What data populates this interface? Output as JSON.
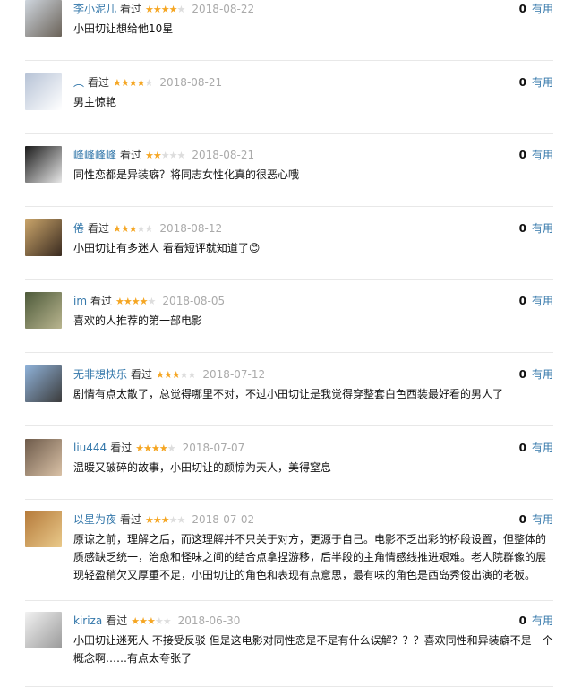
{
  "comments": [
    {
      "user": "李小泥儿",
      "seen": "看过",
      "rating": 4,
      "date": "2018-08-22",
      "votes": "0",
      "useful": "有用",
      "text": "小田切让想给他10星",
      "avatar_colors": [
        "#cfd6de",
        "#6a6258"
      ]
    },
    {
      "user": "︵",
      "seen": "看过",
      "rating": 4,
      "date": "2018-08-21",
      "votes": "0",
      "useful": "有用",
      "text": "男主惊艳",
      "avatar_colors": [
        "#b7c3d6",
        "#ffffff"
      ]
    },
    {
      "user": "峰峰峰峰",
      "seen": "看过",
      "rating": 2,
      "date": "2018-08-21",
      "votes": "0",
      "useful": "有用",
      "text": "同性恋都是异装癖？将同志女性化真的很恶心哦",
      "avatar_colors": [
        "#1a1a1a",
        "#e8e8e8"
      ]
    },
    {
      "user": "倦",
      "seen": "看过",
      "rating": 3,
      "date": "2018-08-12",
      "votes": "0",
      "useful": "有用",
      "text": "小田切让有多迷人 看看短评就知道了😊",
      "avatar_colors": [
        "#c9a46a",
        "#3a2b20"
      ]
    },
    {
      "user": "im",
      "seen": "看过",
      "rating": 4,
      "date": "2018-08-05",
      "votes": "0",
      "useful": "有用",
      "text": "喜欢的人推荐的第一部电影",
      "avatar_colors": [
        "#4d5a3a",
        "#b9b58f"
      ]
    },
    {
      "user": "无非想快乐",
      "seen": "看过",
      "rating": 3,
      "date": "2018-07-12",
      "votes": "0",
      "useful": "有用",
      "text": "剧情有点太散了，总觉得哪里不对，不过小田切让是我觉得穿整套白色西装最好看的男人了",
      "avatar_colors": [
        "#8fb2d9",
        "#3c3c3c"
      ]
    },
    {
      "user": "liu444",
      "seen": "看过",
      "rating": 4,
      "date": "2018-07-07",
      "votes": "0",
      "useful": "有用",
      "text": "温暖又破碎的故事，小田切让的颜惊为天人，美得窒息",
      "avatar_colors": [
        "#6d5a4a",
        "#d9c1a6"
      ]
    },
    {
      "user": "以星为夜",
      "seen": "看过",
      "rating": 3,
      "date": "2018-07-02",
      "votes": "0",
      "useful": "有用",
      "text": "原谅之前，理解之后，而这理解并不只关于对方，更源于自己。电影不乏出彩的桥段设置，但整体的质感缺乏统一，治愈和怪味之间的结合点拿捏游移，后半段的主角情感线推进艰难。老人院群像的展现轻盈稍欠又厚重不足，小田切让的角色和表现有点意思，最有味的角色是西岛秀俊出演的老板。",
      "avatar_colors": [
        "#b57a3a",
        "#e9c98a"
      ]
    },
    {
      "user": "kiriza",
      "seen": "看过",
      "rating": 3,
      "date": "2018-06-30",
      "votes": "0",
      "useful": "有用",
      "text": "小田切让迷死人 不接受反驳 但是这电影对同性恋是不是有什么误解？？？喜欢同性和异装癖不是一个概念啊……有点太夸张了",
      "avatar_colors": [
        "#f2f2f2",
        "#9a9a9a"
      ]
    }
  ]
}
